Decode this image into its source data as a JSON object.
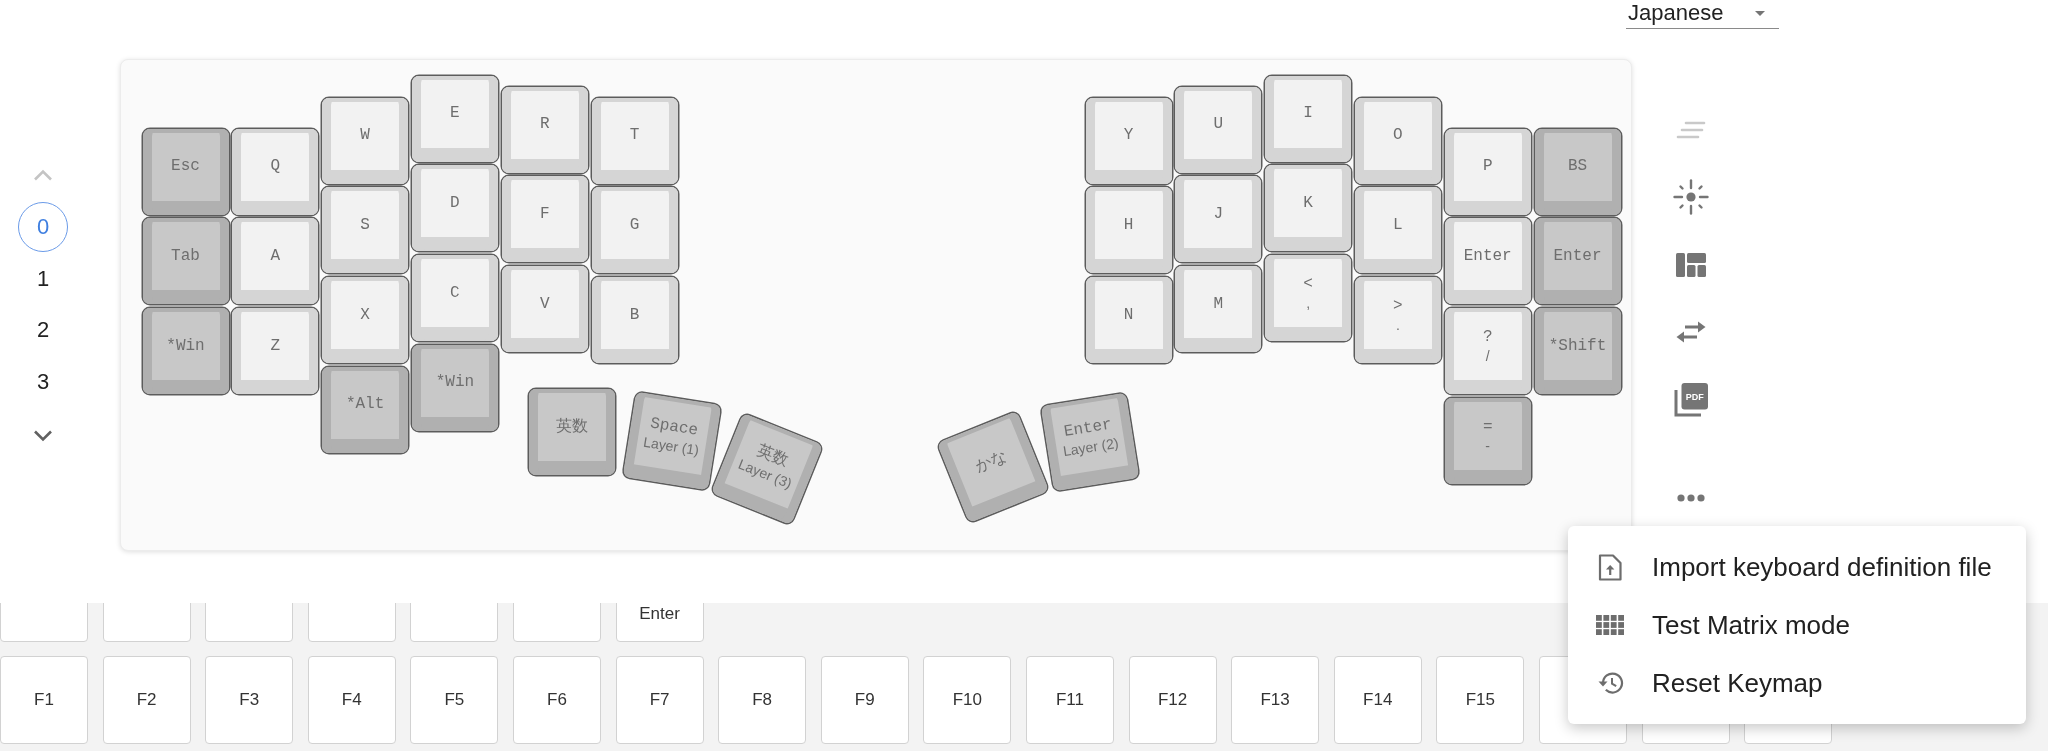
{
  "language_select": {
    "value": "Japanese"
  },
  "layer_selector": {
    "up": {
      "disabled": true
    },
    "layers": [
      {
        "label": "0",
        "selected": true
      },
      {
        "label": "1",
        "selected": false
      },
      {
        "label": "2",
        "selected": false
      },
      {
        "label": "3",
        "selected": false
      }
    ],
    "down": {
      "disabled": false
    }
  },
  "keyboard": {
    "left": {
      "columns": [
        [
          {
            "label": "Esc",
            "color": "#c8c8c8"
          },
          {
            "label": "Tab",
            "color": "#c8c8c8"
          },
          {
            "label": "*Win",
            "color": "#c8c8c8"
          }
        ],
        [
          {
            "label": "Q",
            "color": "#f2f2f2"
          },
          {
            "label": "A",
            "color": "#f2f2f2"
          },
          {
            "label": "Z",
            "color": "#f2f2f2"
          }
        ],
        [
          {
            "label": "W",
            "color": "#f2f2f2"
          },
          {
            "label": "S",
            "color": "#f2f2f2"
          },
          {
            "label": "X",
            "color": "#f2f2f2"
          },
          {
            "label": "*Alt",
            "color": "#c8c8c8"
          }
        ],
        [
          {
            "label": "E",
            "color": "#f2f2f2"
          },
          {
            "label": "D",
            "color": "#f2f2f2"
          },
          {
            "label": "C",
            "color": "#f2f2f2"
          },
          {
            "label": "*Win",
            "color": "#c8c8c8"
          }
        ],
        [
          {
            "label": "R",
            "color": "#f2f2f2"
          },
          {
            "label": "F",
            "color": "#f2f2f2"
          },
          {
            "label": "V",
            "color": "#f2f2f2"
          }
        ],
        [
          {
            "label": "T",
            "color": "#f2f2f2"
          },
          {
            "label": "G",
            "color": "#f2f2f2"
          },
          {
            "label": "B",
            "color": "#f2f2f2"
          }
        ]
      ],
      "thumbs": [
        {
          "label": "英数",
          "color": "#c8c8c8"
        },
        {
          "label": "Space",
          "sublabel": "Layer (1)",
          "color": "#c8c8c8"
        },
        {
          "label": "英数",
          "sublabel": "Layer (3)",
          "color": "#c8c8c8"
        }
      ]
    },
    "right": {
      "columns": [
        [
          {
            "label": "Y",
            "color": "#f2f2f2"
          },
          {
            "label": "H",
            "color": "#f2f2f2"
          },
          {
            "label": "N",
            "color": "#f2f2f2"
          }
        ],
        [
          {
            "label": "U",
            "color": "#f2f2f2"
          },
          {
            "label": "J",
            "color": "#f2f2f2"
          },
          {
            "label": "M",
            "color": "#f2f2f2"
          }
        ],
        [
          {
            "label": "I",
            "color": "#f2f2f2"
          },
          {
            "label": "K",
            "color": "#f2f2f2"
          },
          {
            "label": "<",
            "sublabel": ",",
            "color": "#f2f2f2"
          }
        ],
        [
          {
            "label": "O",
            "color": "#f2f2f2"
          },
          {
            "label": "L",
            "color": "#f2f2f2"
          },
          {
            "label": ">",
            "sublabel": ".",
            "color": "#f2f2f2"
          }
        ],
        [
          {
            "label": "P",
            "color": "#f2f2f2"
          },
          {
            "label": "Enter",
            "color": "#f2f2f2"
          },
          {
            "label": "?",
            "sublabel": "/",
            "color": "#f2f2f2"
          },
          {
            "label": "=",
            "sublabel": "-",
            "color": "#c8c8c8"
          }
        ],
        [
          {
            "label": "BS",
            "color": "#c8c8c8"
          },
          {
            "label": "Enter",
            "color": "#c8c8c8"
          },
          {
            "label": "*Shift",
            "color": "#c8c8c8"
          }
        ]
      ],
      "thumbs": [
        {
          "label": "かな",
          "color": "#c8c8c8"
        },
        {
          "label": "Enter",
          "sublabel": "Layer (2)",
          "color": "#c8c8c8"
        }
      ]
    }
  },
  "toolbar": {
    "buttons": [
      {
        "disabled": true
      },
      {
        "disabled": false
      },
      {
        "disabled": false
      },
      {
        "disabled": false
      },
      {
        "disabled": false,
        "label": "PDF"
      }
    ]
  },
  "menu": {
    "items": [
      {
        "label": "Import keyboard definition file"
      },
      {
        "label": "Test Matrix mode"
      },
      {
        "label": "Reset Keymap"
      }
    ]
  },
  "keycode_palette": {
    "rows": [
      [
        {},
        {},
        {},
        {},
        {},
        {},
        {
          "label": "Enter"
        }
      ],
      [
        {
          "label": "F1"
        },
        {
          "label": "F2"
        },
        {
          "label": "F3"
        },
        {
          "label": "F4"
        },
        {
          "label": "F5"
        },
        {
          "label": "F6"
        },
        {
          "label": "F7"
        },
        {
          "label": "F8"
        },
        {
          "label": "F9"
        },
        {
          "label": "F10"
        },
        {
          "label": "F11"
        },
        {
          "label": "F12"
        },
        {
          "label": "F13"
        },
        {
          "label": "F14"
        },
        {
          "label": "F15"
        },
        {},
        {},
        {}
      ]
    ]
  }
}
